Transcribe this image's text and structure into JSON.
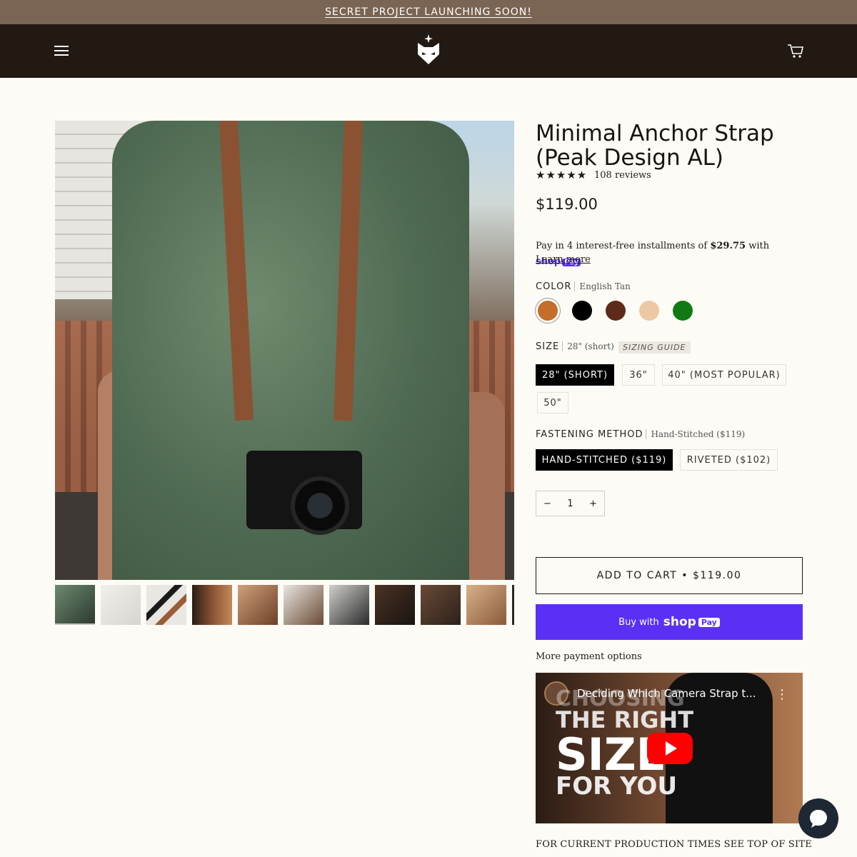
{
  "announcement": "SECRET PROJECT LAUNCHING SOON!",
  "header": {
    "menu_icon": "hamburger-icon",
    "logo_icon": "fox-logo-icon",
    "cart_icon": "cart-icon"
  },
  "gallery": {
    "thumbnails": 11
  },
  "product": {
    "title": "Minimal Anchor Strap (Peak Design AL)",
    "stars": "★★★★★",
    "reviews": "108 reviews",
    "price": "$119.00"
  },
  "installments": {
    "prefix": "Pay in 4 interest-free installments of ",
    "amount": "$29.75",
    "suffix": " with ",
    "shop": "shop",
    "pay": "Pay",
    "learn_more": "Learn more"
  },
  "color": {
    "label": "COLOR",
    "selected": "English Tan",
    "swatches": [
      "#c56d2a",
      "#000000",
      "#5e2a1a",
      "#ecc8a4",
      "#0f7a12"
    ]
  },
  "size": {
    "label": "SIZE",
    "selected": "28\" (short)",
    "guide": "SIZING GUIDE",
    "options": [
      "28\" (SHORT)",
      "36\"",
      "40\" (MOST POPULAR)",
      "50\""
    ]
  },
  "fastening": {
    "label": "FASTENING METHOD",
    "selected": "Hand-Stitched ($119)",
    "options": [
      "HAND-STITCHED ($119)",
      "RIVETED ($102)"
    ]
  },
  "quantity": {
    "minus": "−",
    "value": "1",
    "plus": "+"
  },
  "buttons": {
    "add_to_cart": "ADD TO CART • $119.00",
    "buy_with": "Buy with",
    "shop": "shop",
    "pay": "Pay",
    "more_options": "More payment options"
  },
  "video": {
    "title": "Deciding Which Camera Strap t...",
    "line1": "CHOOSING",
    "line2": "THE RIGHT",
    "line3": "SIZE",
    "line4": "FOR YOU"
  },
  "production_note": "FOR CURRENT PRODUCTION TIMES SEE TOP OF SITE"
}
